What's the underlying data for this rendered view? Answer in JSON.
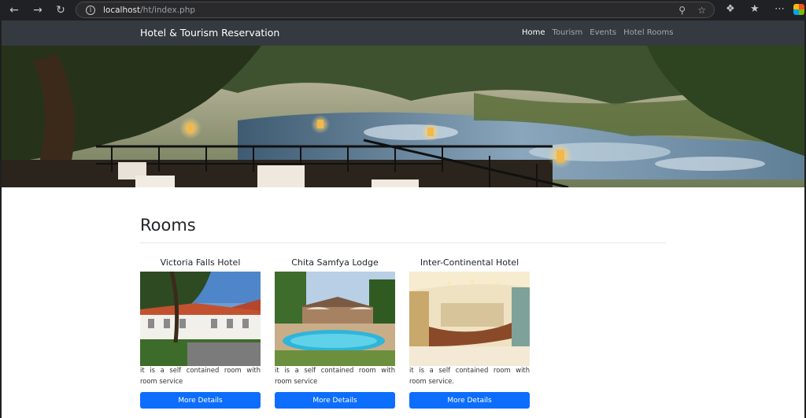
{
  "browser": {
    "url_host": "localhost",
    "url_path": "/ht/index.php"
  },
  "site": {
    "brand": "Hotel & Tourism Reservation",
    "nav": [
      {
        "label": "Home",
        "active": true
      },
      {
        "label": "Tourism",
        "active": false
      },
      {
        "label": "Events",
        "active": false
      },
      {
        "label": "Hotel Rooms",
        "active": false
      }
    ]
  },
  "main": {
    "title": "Rooms",
    "rooms": [
      {
        "name": "Victoria Falls Hotel",
        "description": "it is a self contained room with room service",
        "button": "More Details"
      },
      {
        "name": "Chita Samfya Lodge",
        "description": "it is a self contained room with room service",
        "button": "More Details"
      },
      {
        "name": "Inter-Continental Hotel",
        "description": "it is a self contained room with room service.",
        "button": "More Details"
      }
    ]
  },
  "colors": {
    "navbar": "#343a40",
    "button": "#0d6efd"
  }
}
